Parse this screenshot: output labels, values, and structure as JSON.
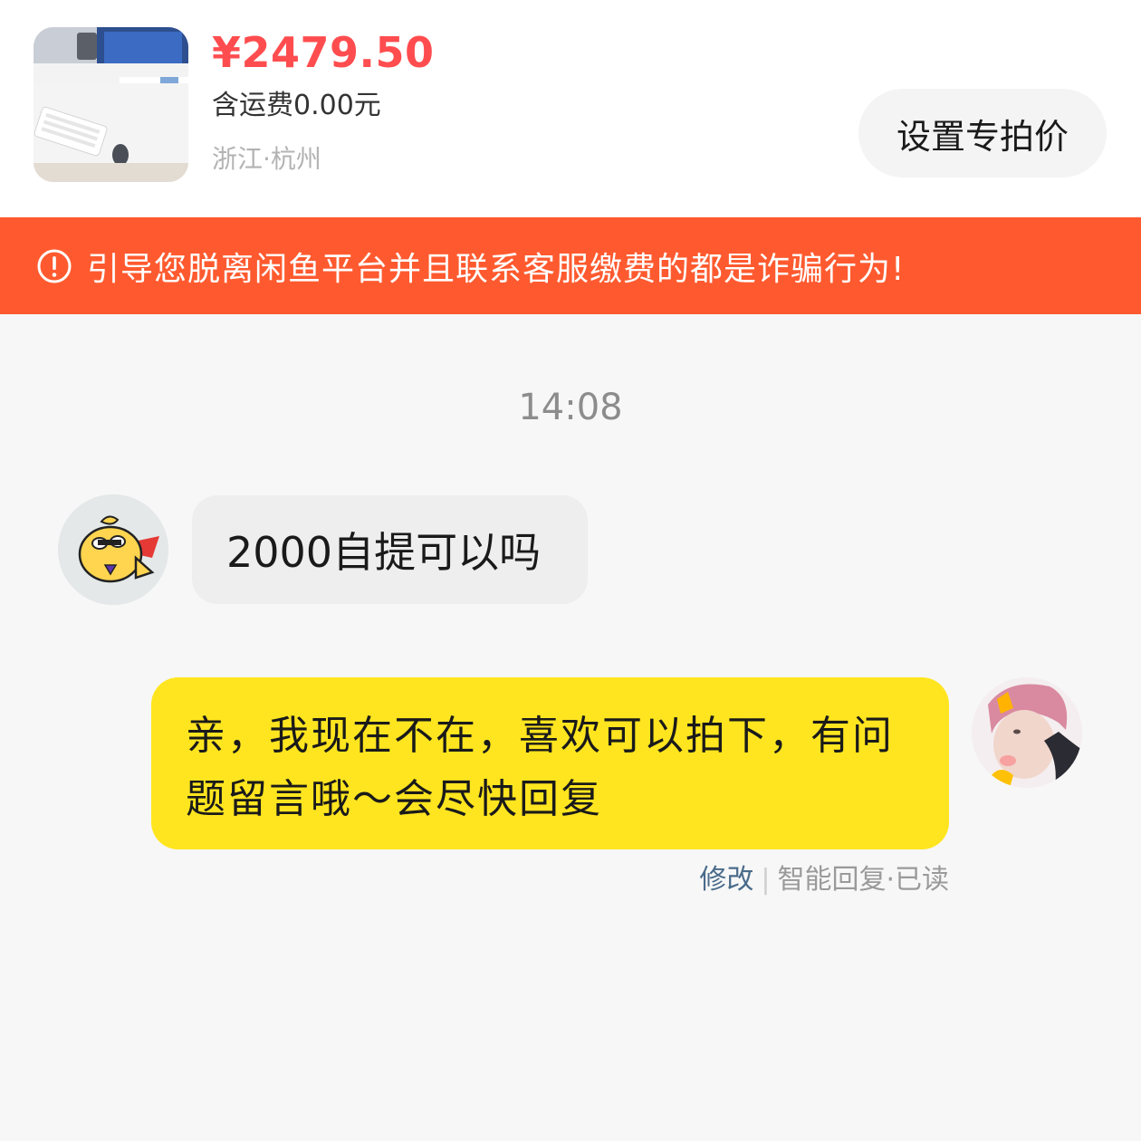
{
  "product": {
    "price": "¥2479.50",
    "shipping": "含运费0.00元",
    "location": "浙江·杭州",
    "thumbnail_icon": "desk-setup-photo",
    "special_price_button": "设置专拍价"
  },
  "warning": {
    "icon": "exclamation-circle-icon",
    "text": "引导您脱离闲鱼平台并且联系客服缴费的都是诈骗行为!"
  },
  "chat": {
    "timestamp": "14:08",
    "messages": [
      {
        "side": "left",
        "avatar": "cartoon-fish-avatar",
        "text": "2000自提可以吗"
      },
      {
        "side": "right",
        "avatar": "user-selfie-avatar",
        "text": "亲，我现在不在，喜欢可以拍下，有问题留言哦～会尽快回复",
        "meta": {
          "edit_label": "修改",
          "separator": "|",
          "status": "智能回复·已读"
        }
      }
    ]
  },
  "colors": {
    "price": "#ff4d4f",
    "warning_bg": "#ff5a2f",
    "my_bubble": "#ffe51f",
    "their_bubble": "#eeeeee"
  }
}
